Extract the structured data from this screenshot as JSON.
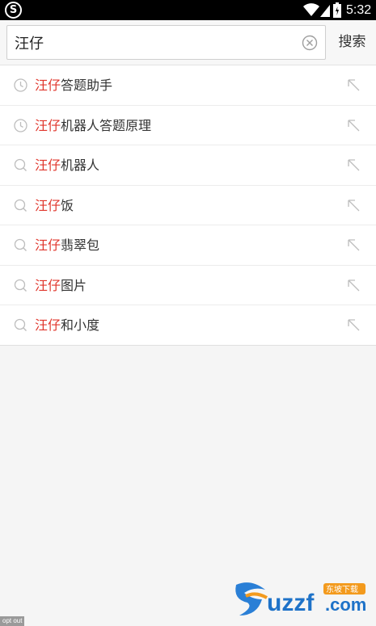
{
  "status_bar": {
    "time": "5:32",
    "left_icon": "S",
    "icons": [
      "wifi-icon",
      "signal-icon",
      "battery-icon"
    ]
  },
  "search": {
    "query": "汪仔",
    "button_label": "搜索",
    "clear_icon": "clear-circle-icon"
  },
  "colors": {
    "highlight": "#e0352b",
    "text": "#333333",
    "icon": "#bdbdbd"
  },
  "suggestions": [
    {
      "prefix": "汪仔",
      "rest": "答题助手",
      "icon": "history-clock-icon"
    },
    {
      "prefix": "汪仔",
      "rest": "机器人答题原理",
      "icon": "history-clock-icon"
    },
    {
      "prefix": "汪仔",
      "rest": "机器人",
      "icon": "search-icon"
    },
    {
      "prefix": "汪仔",
      "rest": "饭",
      "icon": "search-icon"
    },
    {
      "prefix": "汪仔",
      "rest": "翡翠包",
      "icon": "search-icon"
    },
    {
      "prefix": "汪仔",
      "rest": "图片",
      "icon": "search-icon"
    },
    {
      "prefix": "汪仔",
      "rest": "和小度",
      "icon": "search-icon"
    }
  ],
  "footer": {
    "opt_out": "opt out"
  },
  "watermark": {
    "brand": "uzzf.com",
    "tag": "东坡下载"
  }
}
